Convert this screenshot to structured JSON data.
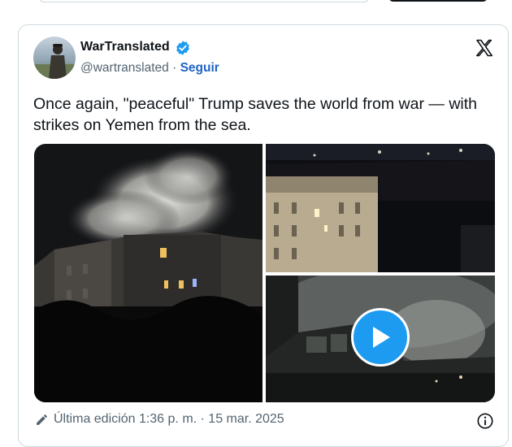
{
  "post": {
    "author_name": "WarTranslated",
    "author_handle": "@wartranslated",
    "separator": " · ",
    "follow_label": "Seguir",
    "text": "Once again, \"peaceful\" Trump saves the world from war — with strikes on Yemen from the sea.",
    "edited_label": "Última edición",
    "timestamp": "1:36 p. m. · 15 mar. 2025"
  },
  "media": {
    "count": 3,
    "has_video": true
  },
  "colors": {
    "accent": "#1d9bf0",
    "follow_link": "#1d63c4",
    "text": "#0f1419",
    "secondary_text": "#536471",
    "border": "#cfd9de"
  },
  "icons": [
    "verified-badge-icon",
    "x-logo-icon",
    "play-icon",
    "pencil-icon",
    "info-icon"
  ]
}
